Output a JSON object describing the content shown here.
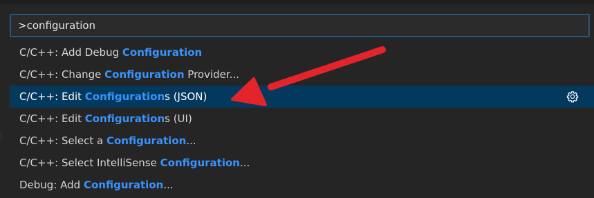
{
  "command_palette": {
    "input_value": ">configuration",
    "input_placeholder": "",
    "items": [
      {
        "before": "C/C++: Add Debug ",
        "match": "Configuration",
        "after": ""
      },
      {
        "before": "C/C++: Change ",
        "match": "Configuration",
        "after": " Provider..."
      },
      {
        "before": "C/C++: Edit ",
        "match": "Configuration",
        "after": "s (JSON)"
      },
      {
        "before": "C/C++: Edit ",
        "match": "Configuration",
        "after": "s (UI)"
      },
      {
        "before": "C/C++: Select a ",
        "match": "Configuration",
        "after": "..."
      },
      {
        "before": "C/C++: Select IntelliSense ",
        "match": "Configuration",
        "after": "..."
      },
      {
        "before": "Debug: Add ",
        "match": "Configuration",
        "after": "..."
      }
    ],
    "selected_index": 2,
    "selected_action_icon": "gear-icon"
  },
  "colors": {
    "match_highlight": "#3794ff",
    "selection_background": "#04395e",
    "annotation_arrow": "#e3252b"
  }
}
